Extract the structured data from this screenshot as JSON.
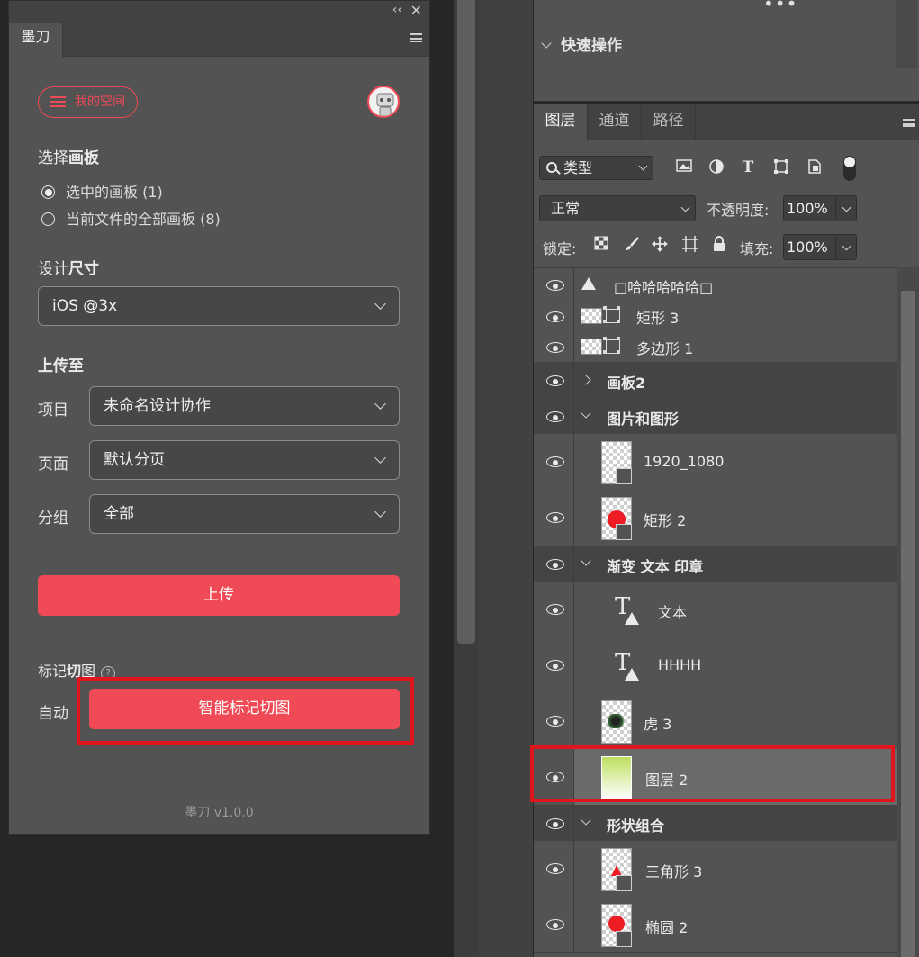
{
  "plugin": {
    "tab": "墨刀",
    "my_space": "我的空间",
    "select_artboard": {
      "prefix": "选择",
      "bold": "画板"
    },
    "radio_selected": "选中的画板 (1)",
    "radio_all": "当前文件的全部画板 (8)",
    "design_size": {
      "prefix": "设计",
      "bold": "尺寸"
    },
    "size_value": "iOS @3x",
    "upload_to": "上传至",
    "project_label": "项目",
    "project_value": "未命名设计协作",
    "page_label": "页面",
    "page_value": "默认分页",
    "group_label": "分组",
    "group_value": "全部",
    "upload_button": "上传",
    "mark_slice": {
      "prefix": "标记",
      "bold": "切",
      "suffix": "图"
    },
    "auto_label": "自动",
    "smart_button": "智能标记切图",
    "version": "墨刀 v1.0.0",
    "collapse_glyph": "‹‹",
    "close_glyph": "✕",
    "help_glyph": "?"
  },
  "quick": {
    "title_bold": "快速操作",
    "dots": "•••"
  },
  "layers": {
    "tabs": [
      "图层",
      "通道",
      "路径"
    ],
    "filter_type": "类型",
    "blend_mode": "正常",
    "opacity_label": "不透明度:",
    "opacity_value": "100%",
    "lock_label": "锁定:",
    "fill_label": "填充:",
    "fill_value": "100%",
    "items": [
      {
        "name": "□哈哈哈哈哈□"
      },
      {
        "name": "矩形 3"
      },
      {
        "name": "多边形 1"
      },
      {
        "name": "画板2"
      },
      {
        "name": "图片和图形"
      },
      {
        "name": "1920_1080"
      },
      {
        "name": "矩形 2"
      },
      {
        "name": "渐变 文本 印章"
      },
      {
        "name": "文本"
      },
      {
        "name": "HHHH"
      },
      {
        "name": "虎 3"
      },
      {
        "name": "图层 2"
      },
      {
        "name": "形状组合"
      },
      {
        "name": "三角形 3"
      },
      {
        "name": "椭圆 2"
      }
    ]
  },
  "colors": {
    "accent": "#ef4a55",
    "annotation": "#e0161e",
    "panel": "#535353"
  }
}
